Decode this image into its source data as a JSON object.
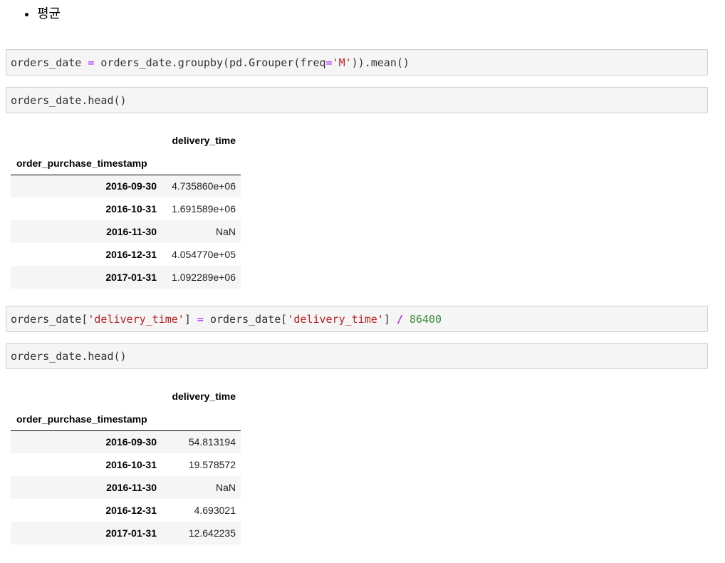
{
  "markdown": {
    "bullet": "평균"
  },
  "cells": [
    {
      "tokens": [
        {
          "t": "orders_date ",
          "c": ""
        },
        {
          "t": "=",
          "c": "op"
        },
        {
          "t": " orders_date.groupby(pd.Grouper(freq",
          "c": ""
        },
        {
          "t": "=",
          "c": "op"
        },
        {
          "t": "'M'",
          "c": "str"
        },
        {
          "t": ")).mean()",
          "c": ""
        }
      ]
    },
    {
      "tokens": [
        {
          "t": "orders_date.head()",
          "c": ""
        }
      ]
    },
    {
      "tokens": [
        {
          "t": "orders_date[",
          "c": ""
        },
        {
          "t": "'delivery_time'",
          "c": "str"
        },
        {
          "t": "] ",
          "c": ""
        },
        {
          "t": "=",
          "c": "op"
        },
        {
          "t": " orders_date[",
          "c": ""
        },
        {
          "t": "'delivery_time'",
          "c": "str"
        },
        {
          "t": "] ",
          "c": ""
        },
        {
          "t": "/",
          "c": "slash"
        },
        {
          "t": " ",
          "c": ""
        },
        {
          "t": "86400",
          "c": "num"
        }
      ]
    },
    {
      "tokens": [
        {
          "t": "orders_date.head()",
          "c": ""
        }
      ]
    }
  ],
  "tables": [
    {
      "column": "delivery_time",
      "index_name": "order_purchase_timestamp",
      "rows": [
        {
          "index": "2016-09-30",
          "value": "4.735860e+06"
        },
        {
          "index": "2016-10-31",
          "value": "1.691589e+06"
        },
        {
          "index": "2016-11-30",
          "value": "NaN"
        },
        {
          "index": "2016-12-31",
          "value": "4.054770e+05"
        },
        {
          "index": "2017-01-31",
          "value": "1.092289e+06"
        }
      ]
    },
    {
      "column": "delivery_time",
      "index_name": "order_purchase_timestamp",
      "rows": [
        {
          "index": "2016-09-30",
          "value": "54.813194"
        },
        {
          "index": "2016-10-31",
          "value": "19.578572"
        },
        {
          "index": "2016-11-30",
          "value": "NaN"
        },
        {
          "index": "2016-12-31",
          "value": "4.693021"
        },
        {
          "index": "2017-01-31",
          "value": "12.642235"
        }
      ]
    }
  ]
}
